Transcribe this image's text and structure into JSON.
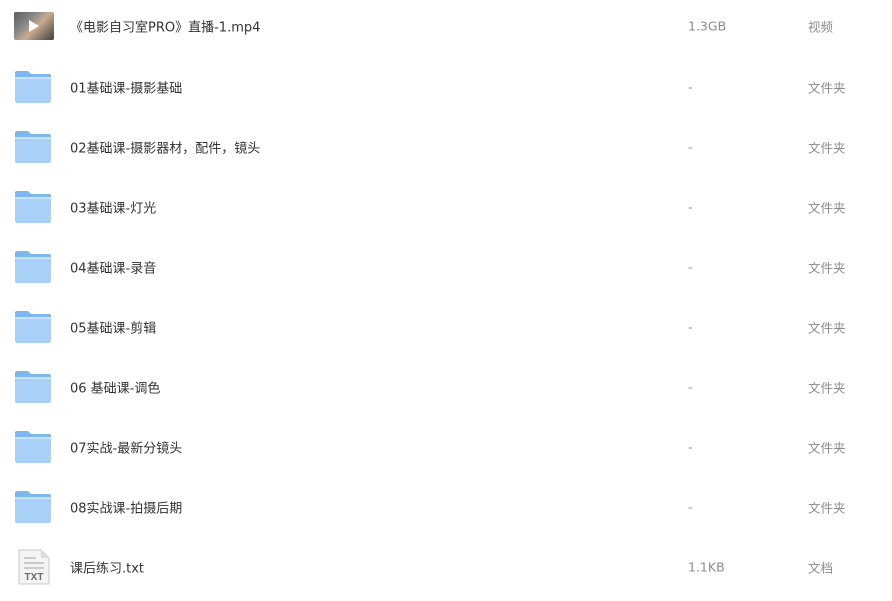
{
  "files": [
    {
      "name": "《电影自习室PRO》直播-1.mp4",
      "size": "1.3GB",
      "type": "视频",
      "icon": "video-thumbnail"
    },
    {
      "name": "01基础课-摄影基础",
      "size": "-",
      "type": "文件夹",
      "icon": "folder-icon"
    },
    {
      "name": "02基础课-摄影器材，配件，镜头",
      "size": "-",
      "type": "文件夹",
      "icon": "folder-icon"
    },
    {
      "name": "03基础课-灯光",
      "size": "-",
      "type": "文件夹",
      "icon": "folder-icon"
    },
    {
      "name": "04基础课-录音",
      "size": "-",
      "type": "文件夹",
      "icon": "folder-icon"
    },
    {
      "name": "05基础课-剪辑",
      "size": "-",
      "type": "文件夹",
      "icon": "folder-icon"
    },
    {
      "name": "06 基础课-调色",
      "size": "-",
      "type": "文件夹",
      "icon": "folder-icon"
    },
    {
      "name": "07实战-最新分镜头",
      "size": "-",
      "type": "文件夹",
      "icon": "folder-icon"
    },
    {
      "name": "08实战课-拍摄后期",
      "size": "-",
      "type": "文件夹",
      "icon": "folder-icon"
    },
    {
      "name": "课后练习.txt",
      "size": "1.1KB",
      "type": "文档",
      "icon": "txt-file-icon",
      "icon_label": "TXT"
    }
  ],
  "colors": {
    "folder_back": "#7db7ec",
    "folder_front": "#a9d1f7",
    "text_primary": "#333333",
    "text_secondary": "#8c8c8c"
  }
}
